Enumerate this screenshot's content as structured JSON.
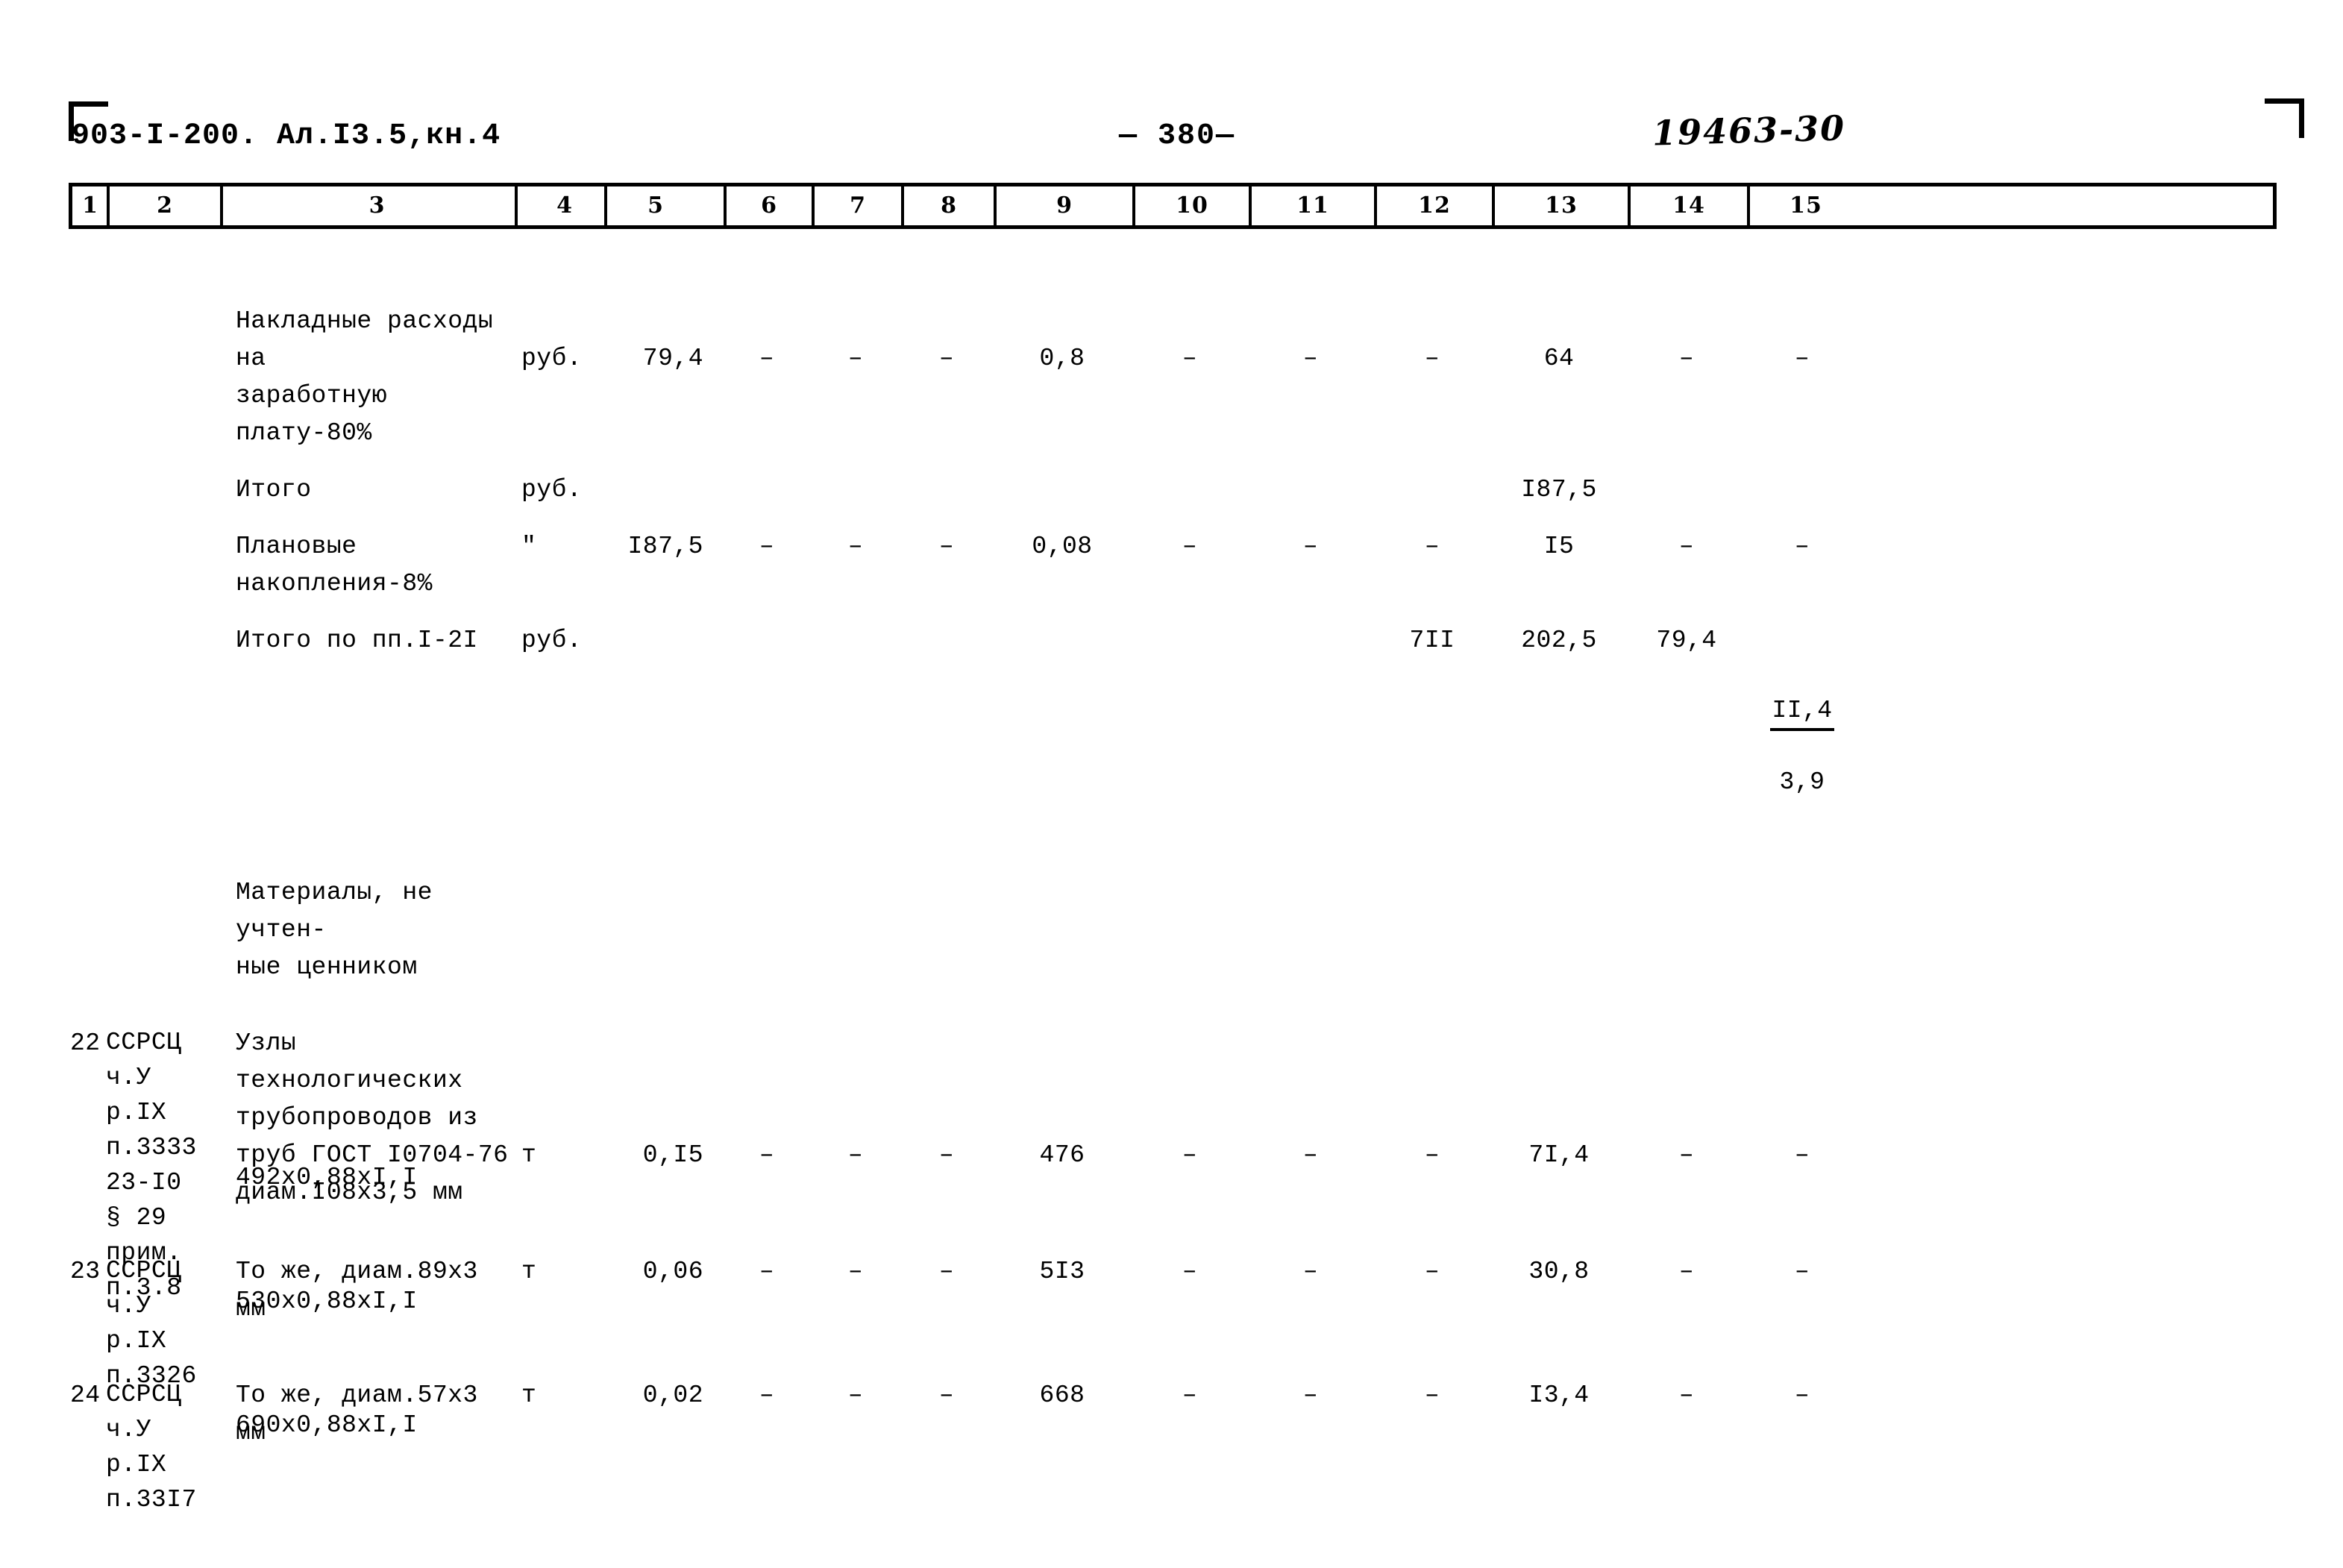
{
  "header": {
    "doc_code": "903-I-200. Ал.I3.5,кн.4",
    "page_number": "— 380—",
    "hand_note": "19463-30"
  },
  "table": {
    "column_headers": [
      "1",
      "2",
      "3",
      "4",
      "5",
      "6",
      "7",
      "8",
      "9",
      "10",
      "11",
      "12",
      "13",
      "14",
      "15"
    ],
    "rows": [
      {
        "num": "",
        "justification": "",
        "description": "Накладные расходы на\nзаработную плату-80%",
        "unit": "руб.",
        "qty": "79,4",
        "v6": "–",
        "v7": "–",
        "v8": "–",
        "v9": "0,8",
        "v10": "–",
        "v11": "–",
        "v12": "–",
        "v13": "64",
        "v14": "–",
        "v15": "–"
      },
      {
        "num": "",
        "justification": "",
        "description": "Итого",
        "unit": "руб.",
        "qty": "",
        "v6": "",
        "v7": "",
        "v8": "",
        "v9": "",
        "v10": "",
        "v11": "",
        "v12": "",
        "v13": "I87,5",
        "v14": "",
        "v15": ""
      },
      {
        "num": "",
        "justification": "",
        "description": "Плановые накопления-8%",
        "unit": "\"",
        "qty": "I87,5",
        "v6": "–",
        "v7": "–",
        "v8": "–",
        "v9": "0,08",
        "v10": "–",
        "v11": "–",
        "v12": "–",
        "v13": "I5",
        "v14": "–",
        "v15": "–"
      },
      {
        "num": "",
        "justification": "",
        "description": "Итого по пп.I-2I",
        "unit": "руб.",
        "qty": "",
        "v6": "",
        "v7": "",
        "v8": "",
        "v9": "",
        "v10": "",
        "v11": "",
        "v12": "7II",
        "v13": "202,5",
        "v14": "79,4",
        "v15_fraction": {
          "top": "II,4",
          "bottom": "3,9"
        }
      },
      {
        "num": "",
        "justification": "",
        "description": "Материалы, не учтен-\n   ные ценником",
        "unit": "",
        "qty": "",
        "v6": "",
        "v7": "",
        "v8": "",
        "v9": "",
        "v10": "",
        "v11": "",
        "v12": "",
        "v13": "",
        "v14": "",
        "v15": ""
      },
      {
        "num": "22",
        "justification": "ССРСЦ\n  ч.У\n  р.IX\n  п.3333\n  23-I0\n  § 29\n прим.\n п.3.8",
        "description": "Узлы технологических\nтрубопроводов из\nтруб ГОСТ I0704-76\nдиам.I08х3,5 мм",
        "description2": "492х0,88хI,I",
        "unit": "т",
        "qty": "0,I5",
        "v6": "–",
        "v7": "–",
        "v8": "–",
        "v9": "476",
        "v10": "–",
        "v11": "–",
        "v12": "–",
        "v13": "7I,4",
        "v14": "–",
        "v15": "–"
      },
      {
        "num": "23",
        "justification": "ССРСЦ\n  ч.У\n  р.IX\n  п.3326",
        "description": "То же, диам.89х3 мм",
        "description2": "530х0,88хI,I",
        "unit": "т",
        "qty": "0,06",
        "v6": "–",
        "v7": "–",
        "v8": "–",
        "v9": "5I3",
        "v10": "–",
        "v11": "–",
        "v12": "–",
        "v13": "30,8",
        "v14": "–",
        "v15": "–"
      },
      {
        "num": "24",
        "justification": "ССРСЦ\n  ч.У\n  р.IX\n  п.33I7",
        "description": "То же, диам.57х3 мм",
        "description2": "690х0,88хI,I",
        "unit": "т",
        "qty": "0,02",
        "v6": "–",
        "v7": "–",
        "v8": "–",
        "v9": "668",
        "v10": "–",
        "v11": "–",
        "v12": "–",
        "v13": "I3,4",
        "v14": "–",
        "v15": "–"
      }
    ]
  }
}
